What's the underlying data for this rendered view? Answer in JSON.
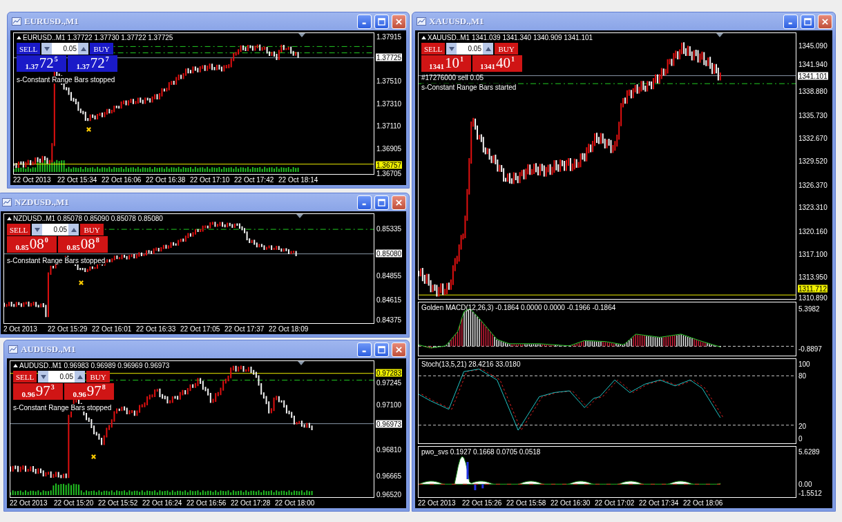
{
  "windows": [
    {
      "title": "EURUSD.,M1",
      "header": "EURUSD..M1 1.37722 1.37730 1.37722 1.37725",
      "color": "#1a1ac8",
      "sell_label": "SELL",
      "buy_label": "BUY",
      "lot": "0.05",
      "sell_price": {
        "base": "1.37",
        "pips": "72",
        "point": "5"
      },
      "buy_price": {
        "base": "1.37",
        "pips": "72",
        "point": "7"
      },
      "status": "s-Constant Range Bars stopped",
      "price_axis": [
        {
          "text": "1.37915",
          "kind": "tick"
        },
        {
          "text": "1.37725",
          "kind": "current"
        },
        {
          "text": "1.37510",
          "kind": "tick"
        },
        {
          "text": "1.37310",
          "kind": "tick"
        },
        {
          "text": "1.37110",
          "kind": "tick"
        },
        {
          "text": "1.36905",
          "kind": "tick"
        },
        {
          "text": "1.36757",
          "kind": "marker"
        },
        {
          "text": "1.36705",
          "kind": "tick"
        }
      ],
      "time_axis": [
        "22 Oct 2013",
        "22 Oct 15:34",
        "22 Oct 16:06",
        "22 Oct 16:38",
        "22 Oct 17:10",
        "22 Oct 17:42",
        "22 Oct 18:14"
      ]
    },
    {
      "title": "NZDUSD.,M1",
      "header": "NZDUSD..M1 0.85078 0.85090 0.85078 0.85080",
      "color": "#d01515",
      "sell_label": "SELL",
      "buy_label": "BUY",
      "lot": "0.05",
      "sell_price": {
        "base": "0.85",
        "pips": "08",
        "point": "0"
      },
      "buy_price": {
        "base": "0.85",
        "pips": "08",
        "point": "8"
      },
      "status": "s-Constant Range Bars stopped",
      "price_axis": [
        {
          "text": "0.85335",
          "kind": "tick"
        },
        {
          "text": "0.85080",
          "kind": "current"
        },
        {
          "text": "0.84855",
          "kind": "tick"
        },
        {
          "text": "0.84615",
          "kind": "tick"
        },
        {
          "text": "0.84375",
          "kind": "tick"
        }
      ],
      "time_axis": [
        "2 Oct 2013",
        "22 Oct 15:29",
        "22 Oct 16:01",
        "22 Oct 16:33",
        "22 Oct 17:05",
        "22 Oct 17:37",
        "22 Oct 18:09"
      ]
    },
    {
      "title": "AUDUSD.,M1",
      "header": "AUDUSD..M1 0.96983 0.96989 0.96969 0.96973",
      "color": "#d01515",
      "sell_label": "SELL",
      "buy_label": "BUY",
      "lot": "0.05",
      "sell_price": {
        "base": "0.96",
        "pips": "97",
        "point": "3"
      },
      "buy_price": {
        "base": "0.96",
        "pips": "97",
        "point": "8"
      },
      "status": "s-Constant Range Bars stopped",
      "price_axis": [
        {
          "text": "0.97283",
          "kind": "marker"
        },
        {
          "text": "0.97245",
          "kind": "tick"
        },
        {
          "text": "0.97100",
          "kind": "tick"
        },
        {
          "text": "0.96973",
          "kind": "current"
        },
        {
          "text": "0.96810",
          "kind": "tick"
        },
        {
          "text": "0.96665",
          "kind": "tick"
        },
        {
          "text": "0.96520",
          "kind": "tick"
        }
      ],
      "time_axis": [
        "22 Oct 2013",
        "22 Oct 15:20",
        "22 Oct 15:52",
        "22 Oct 16:24",
        "22 Oct 16:56",
        "22 Oct 17:28",
        "22 Oct 18:00"
      ]
    },
    {
      "title": "XAUUSD.,M1",
      "header": "XAUUSD..M1 1341.039 1341.340 1340.909 1341.101",
      "color": "#d01515",
      "sell_label": "SELL",
      "buy_label": "BUY",
      "lot": "0.05",
      "sell_price": {
        "base": "1341",
        "pips": "10",
        "point": "1"
      },
      "buy_price": {
        "base": "1341",
        "pips": "40",
        "point": "1"
      },
      "order_label": "#17276000 sell 0.05",
      "status": "s-Constant Range Bars started",
      "price_axis": [
        {
          "text": "1345.090",
          "kind": "tick"
        },
        {
          "text": "1341.940",
          "kind": "tick"
        },
        {
          "text": "1341.101",
          "kind": "current"
        },
        {
          "text": "1338.880",
          "kind": "tick"
        },
        {
          "text": "1335.730",
          "kind": "tick"
        },
        {
          "text": "1332.670",
          "kind": "tick"
        },
        {
          "text": "1329.520",
          "kind": "tick"
        },
        {
          "text": "1326.370",
          "kind": "tick"
        },
        {
          "text": "1323.310",
          "kind": "tick"
        },
        {
          "text": "1320.160",
          "kind": "tick"
        },
        {
          "text": "1317.100",
          "kind": "tick"
        },
        {
          "text": "1313.950",
          "kind": "tick"
        },
        {
          "text": "1311.712",
          "kind": "marker"
        },
        {
          "text": "1310.890",
          "kind": "tick"
        }
      ],
      "panes": [
        {
          "kind": "macd",
          "label": "Golden MACD(12,26,3) -0.1864 0.0000 0.0000 -0.1966 -0.1864",
          "axis": [
            "5.3982",
            "-0.8897"
          ]
        },
        {
          "kind": "stoch",
          "label": "Stoch(13,5,21) 28.4216 33.0180",
          "axis": [
            "100",
            "80",
            "20",
            "0"
          ]
        },
        {
          "kind": "pwo",
          "label": "pwo_svs 0.1927 0.1668 0.0705 0.0518",
          "axis": [
            "5.6289",
            "0.00",
            "-1.5512"
          ]
        }
      ],
      "time_axis": [
        "22 Oct 2013",
        "22 Oct 15:26",
        "22 Oct 15:58",
        "22 Oct 16:30",
        "22 Oct 17:02",
        "22 Oct 17:34",
        "22 Oct 18:06"
      ]
    }
  ]
}
